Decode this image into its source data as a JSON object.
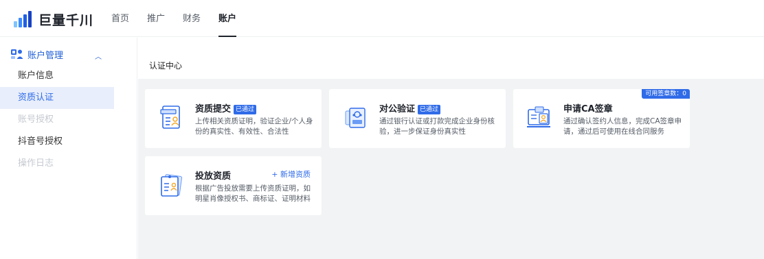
{
  "header": {
    "brand": "巨量千川",
    "nav": [
      {
        "label": "首页"
      },
      {
        "label": "推广"
      },
      {
        "label": "财务"
      },
      {
        "label": "账户"
      }
    ]
  },
  "sidebar": {
    "group_label": "账户管理",
    "items": [
      {
        "label": "账户信息"
      },
      {
        "label": "资质认证"
      },
      {
        "label": "账号授权"
      },
      {
        "label": "抖音号授权"
      },
      {
        "label": "操作日志"
      }
    ]
  },
  "main": {
    "title": "认证中心",
    "cards": [
      {
        "title": "资质提交",
        "badge": "已通过",
        "desc": "上传相关资质证明，验证企业/个人身份的真实性、有效性、合法性",
        "icon": "document-user-icon"
      },
      {
        "title": "对公验证",
        "badge": "已通过",
        "desc": "通过银行认证或打款完成企业身份核验，进一步保证身份真实性",
        "icon": "bank-card-icon"
      },
      {
        "title": "申请CA签章",
        "corner": "可用签章数：0",
        "desc": "通过确认签约人信息，完成CA签章申请，通过后可使用在线合同服务",
        "icon": "signature-computer-icon"
      },
      {
        "title": "投放资质",
        "link": "+ 新增资质",
        "desc": "根据广告投放需要上传资质证明，如明星肖像授权书、商标证、证明材料",
        "icon": "certificate-stack-icon"
      }
    ]
  },
  "colors": {
    "accent": "#2f6be8",
    "body_bg": "#f2f3f5",
    "active_bg": "#e8eefb",
    "disabled": "#c5c9d0"
  }
}
